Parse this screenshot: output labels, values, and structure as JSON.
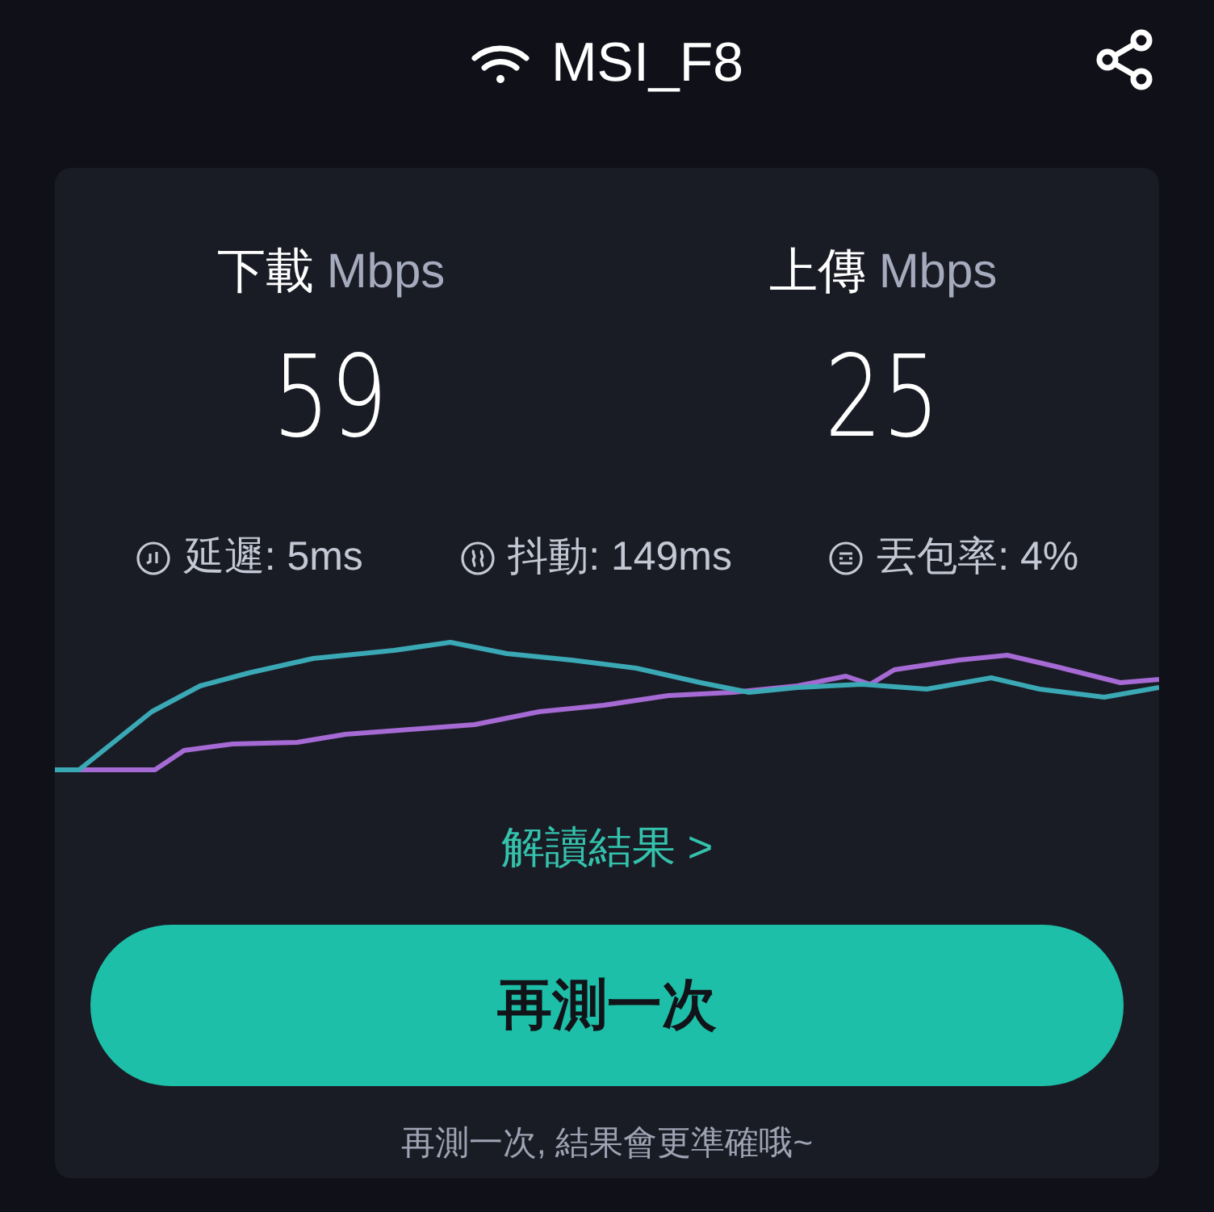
{
  "header": {
    "network_name": "MSI_F8"
  },
  "results": [
    {
      "label": "下載",
      "unit": "Mbps",
      "value": "59"
    },
    {
      "label": "上傳",
      "unit": "Mbps",
      "value": "25"
    }
  ],
  "stats": [
    {
      "kind": "latency",
      "text": "延遲: 5ms"
    },
    {
      "kind": "jitter",
      "text": "抖動: 149ms"
    },
    {
      "kind": "loss",
      "text": "丟包率: 4%"
    }
  ],
  "interpret_link": "解讀結果 >",
  "retest_button": "再測一次",
  "footer_hint": "再測一次, 結果會更準確哦~"
}
